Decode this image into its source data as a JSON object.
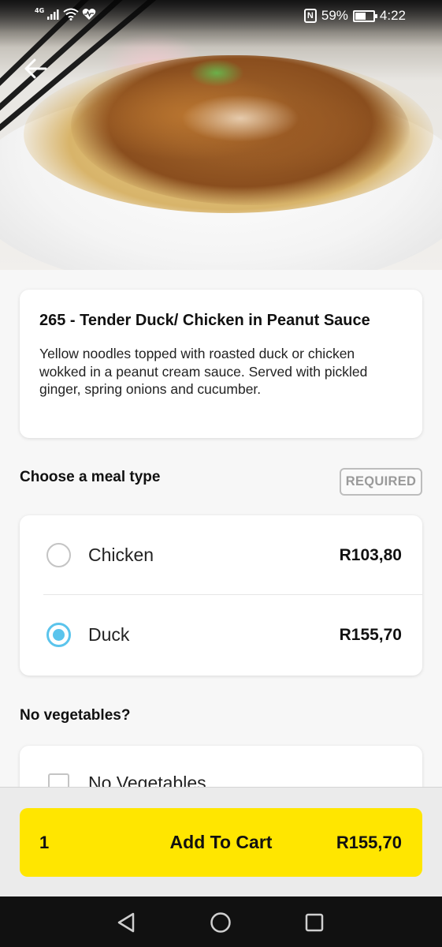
{
  "status_bar": {
    "network": "4G",
    "battery_percent": "59%",
    "time": "4:22",
    "battery_level": 0.59
  },
  "hero": {
    "image_subject": "noodle-dish-photo"
  },
  "dish": {
    "title": "265 - Tender Duck/ Chicken in Peanut Sauce",
    "description": "Yellow noodles topped with roasted duck or chicken wokked in a peanut cream sauce. Served with pickled ginger, spring onions and cucumber."
  },
  "meal_type": {
    "heading": "Choose a meal type",
    "badge": "REQUIRED",
    "options": [
      {
        "label": "Chicken",
        "price": "R103,80",
        "selected": false
      },
      {
        "label": "Duck",
        "price": "R155,70",
        "selected": true
      }
    ]
  },
  "vegetables": {
    "heading": "No vegetables?",
    "option_label": "No Vegetables",
    "checked": false
  },
  "cart": {
    "quantity": "1",
    "button_label": "Add To Cart",
    "total": "R155,70"
  },
  "colors": {
    "accent_yellow": "#ffe600",
    "radio_selected": "#5bc4ec",
    "badge_border": "#bdbdbd"
  },
  "icons": {
    "back": "arrow-left-icon",
    "nav_back": "triangle-back-icon",
    "nav_home": "circle-home-icon",
    "nav_recents": "square-recents-icon"
  }
}
